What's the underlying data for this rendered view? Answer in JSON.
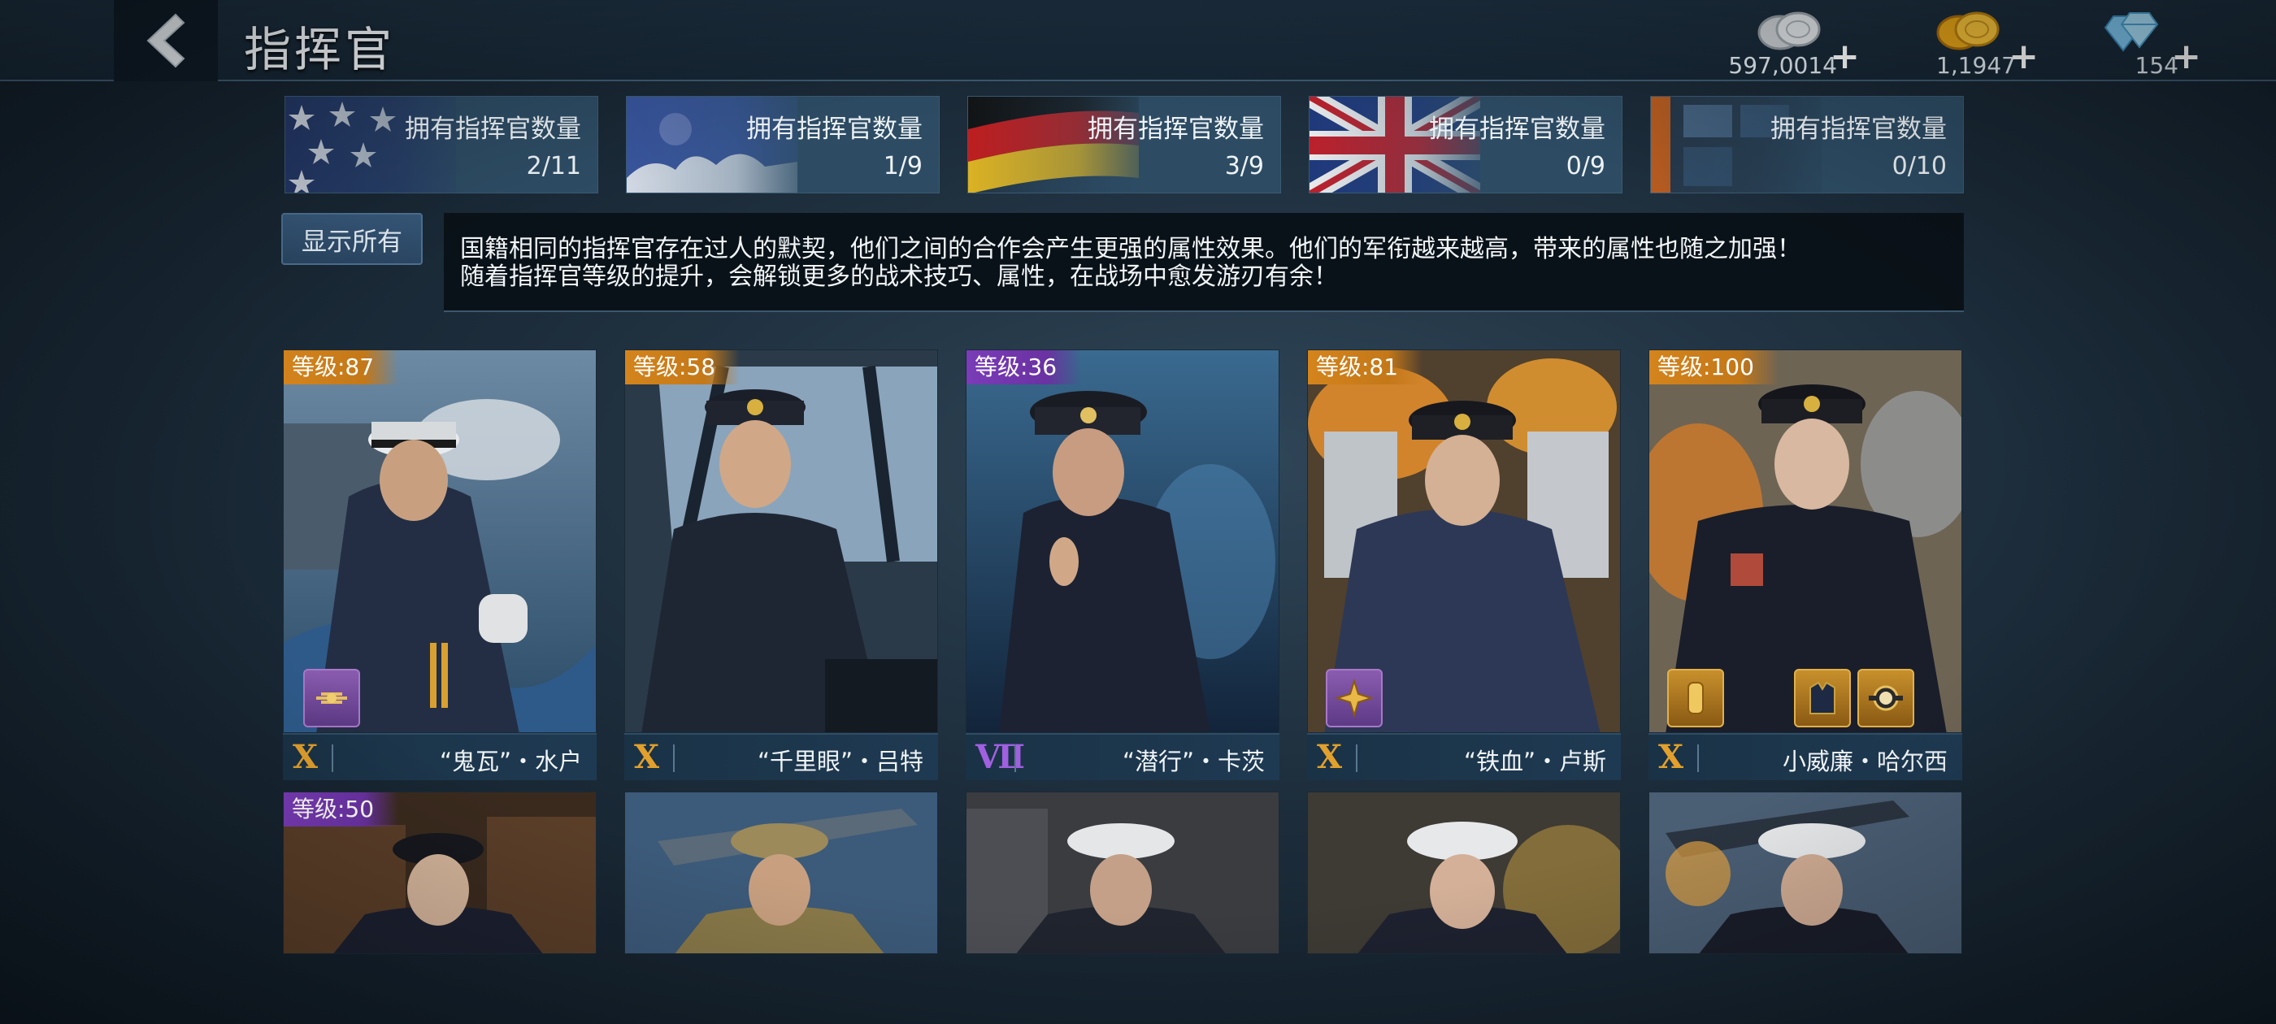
{
  "header": {
    "title": "指挥官",
    "currencies": [
      {
        "icon": "silver-coin-icon",
        "amount": "597,0014"
      },
      {
        "icon": "gold-coin-icon",
        "amount": "1,1947"
      },
      {
        "icon": "diamond-icon",
        "amount": "154"
      }
    ],
    "plus": "+"
  },
  "nations": [
    {
      "flag": "usa-flag",
      "label": "拥有指挥官数量",
      "count": "2/11"
    },
    {
      "flag": "japan-flag",
      "label": "拥有指挥官数量",
      "count": "1/9"
    },
    {
      "flag": "germany-flag",
      "label": "拥有指挥官数量",
      "count": "3/9"
    },
    {
      "flag": "uk-flag",
      "label": "拥有指挥官数量",
      "count": "0/9"
    },
    {
      "flag": "other-flag",
      "label": "拥有指挥官数量",
      "count": "0/10"
    }
  ],
  "controls": {
    "show_all": "显示所有"
  },
  "description": {
    "line1": "国籍相同的指挥官存在过人的默契，他们之间的合作会产生更强的属性效果。他们的军衔越来越高，带来的属性也随之加强！",
    "line2": "随着指挥官等级的提升，会解锁更多的战术技巧、属性，在战场中愈发游刃有余！"
  },
  "commanders": [
    {
      "level": "等级:87",
      "level_color": "orange",
      "rank": "X",
      "rank_color": "gold",
      "name": "“鬼瓦”・水户",
      "skills": [
        "purple"
      ]
    },
    {
      "level": "等级:58",
      "level_color": "orange",
      "rank": "X",
      "rank_color": "gold",
      "name": "“千里眼”・吕特",
      "skills": []
    },
    {
      "level": "等级:36",
      "level_color": "purple",
      "rank": "Ⅶ",
      "rank_color": "purple",
      "name": "“潜行”・卡茨",
      "skills": []
    },
    {
      "level": "等级:81",
      "level_color": "orange",
      "rank": "X",
      "rank_color": "gold",
      "name": "“铁血”・卢斯",
      "skills": [
        "purple"
      ]
    },
    {
      "level": "等级:100",
      "level_color": "orange",
      "rank": "X",
      "rank_color": "gold",
      "name": "小威廉・哈尔西",
      "skills": [
        "gold",
        "gold",
        "gold"
      ]
    }
  ],
  "commanders_row2": [
    {
      "level": "等级:50",
      "level_color": "purple"
    },
    {
      "level": ""
    },
    {
      "level": ""
    },
    {
      "level": ""
    },
    {
      "level": ""
    }
  ],
  "colors": {
    "level_orange": "#d4841c",
    "level_purple": "#7a3cb8",
    "rank_gold": "#e2a02c",
    "rank_purple": "#a060e0"
  }
}
